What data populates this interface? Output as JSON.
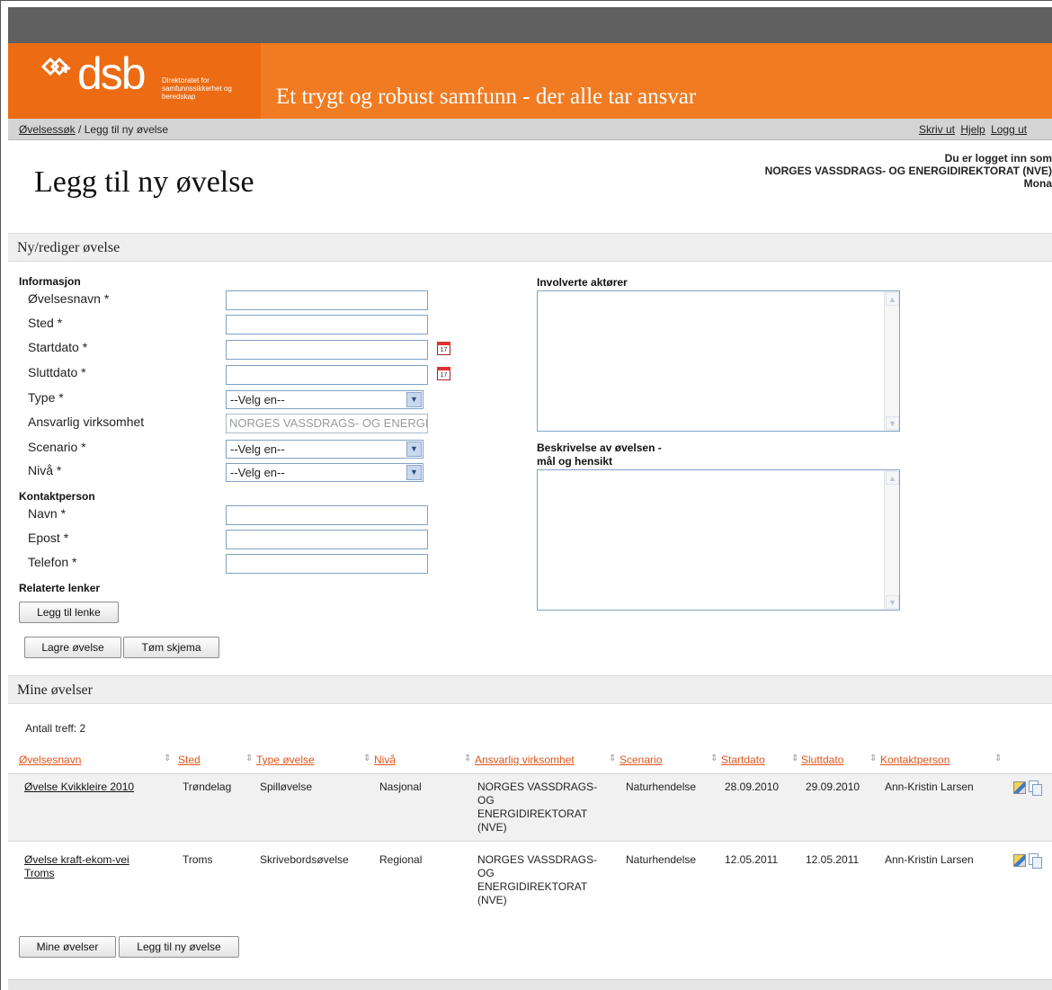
{
  "header": {
    "logo_text": "dsb",
    "logo_sub": "Direktoratet for samfunnssikkerhet og beredskap",
    "slogan": "Et trygt og robust samfunn - der alle tar ansvar"
  },
  "breadcrumb": {
    "link": "Øvelsessøk",
    "separator": "/",
    "current": "Legg til ny øvelse"
  },
  "top_links": [
    "Skriv ut",
    "Hjelp",
    "Logg ut"
  ],
  "login": {
    "line1": "Du er logget inn som",
    "org": "NORGES VASSDRAGS- OG ENERGIDIREKTORAT (NVE)",
    "user": "Mona"
  },
  "page_title": "Legg til ny øvelse",
  "form_section": {
    "title": "Ny/rediger øvelse",
    "informasjon": "Informasjon",
    "fields": {
      "ovelsesnavn": "Øvelsesnavn *",
      "sted": "Sted *",
      "startdato": "Startdato *",
      "sluttdato": "Sluttdato *",
      "type": "Type *",
      "ansvarlig": "Ansvarlig virksomhet",
      "scenario": "Scenario *",
      "niva": "Nivå *"
    },
    "ansvarlig_value": "NORGES VASSDRAGS- OG ENERGIDIREKTORAT (NVE)",
    "select_default": "--Velg en--",
    "calendar_day": "17",
    "kontaktperson": "Kontaktperson",
    "contact_fields": {
      "navn": "Navn *",
      "epost": "Epost *",
      "telefon": "Telefon *"
    },
    "relaterte": "Relaterte lenker",
    "add_link_button": "Legg til lenke",
    "involverte": "Involverte aktører",
    "beskrivelse_1": "Beskrivelse av øvelsen -",
    "beskrivelse_2": "mål og hensikt",
    "save_button": "Lagre øvelse",
    "clear_button": "Tøm skjema"
  },
  "list_section": {
    "title": "Mine øvelser",
    "count_label": "Antall treff: 2",
    "columns": [
      "Øvelsesnavn",
      "Sted",
      "Type øvelse",
      "Nivå",
      "Ansvarlig virksomhet",
      "Scenario",
      "Startdato",
      "Sluttdato",
      "Kontaktperson"
    ],
    "rows": [
      {
        "name": "Øvelse Kvikkleire 2010",
        "name_l2": "",
        "sted": "Trøndelag",
        "type": "Spilløvelse",
        "niva": "Nasjonal",
        "ansvarlig": [
          "NORGES VASSDRAGS-",
          "OG",
          "ENERGIDIREKTORAT",
          "(NVE)"
        ],
        "scenario": "Naturhendelse",
        "start": "28.09.2010",
        "slutt": "29.09.2010",
        "kontakt": "Ann-Kristin Larsen"
      },
      {
        "name": "Øvelse kraft-ekom-vei",
        "name_l2": "Troms",
        "sted": "Troms",
        "type": "Skrivebordsøvelse",
        "niva": "Regional",
        "ansvarlig": [
          "NORGES VASSDRAGS-",
          "OG",
          "ENERGIDIREKTORAT",
          "(NVE)"
        ],
        "scenario": "Naturhendelse",
        "start": "12.05.2011",
        "slutt": "12.05.2011",
        "kontakt": "Ann-Kristin Larsen"
      }
    ],
    "my_button": "Mine øvelser",
    "new_button": "Legg til ny øvelse"
  },
  "colors": {
    "brand_orange": "#f07b22",
    "link_orange": "#e2541a",
    "top_gray": "#606060"
  }
}
